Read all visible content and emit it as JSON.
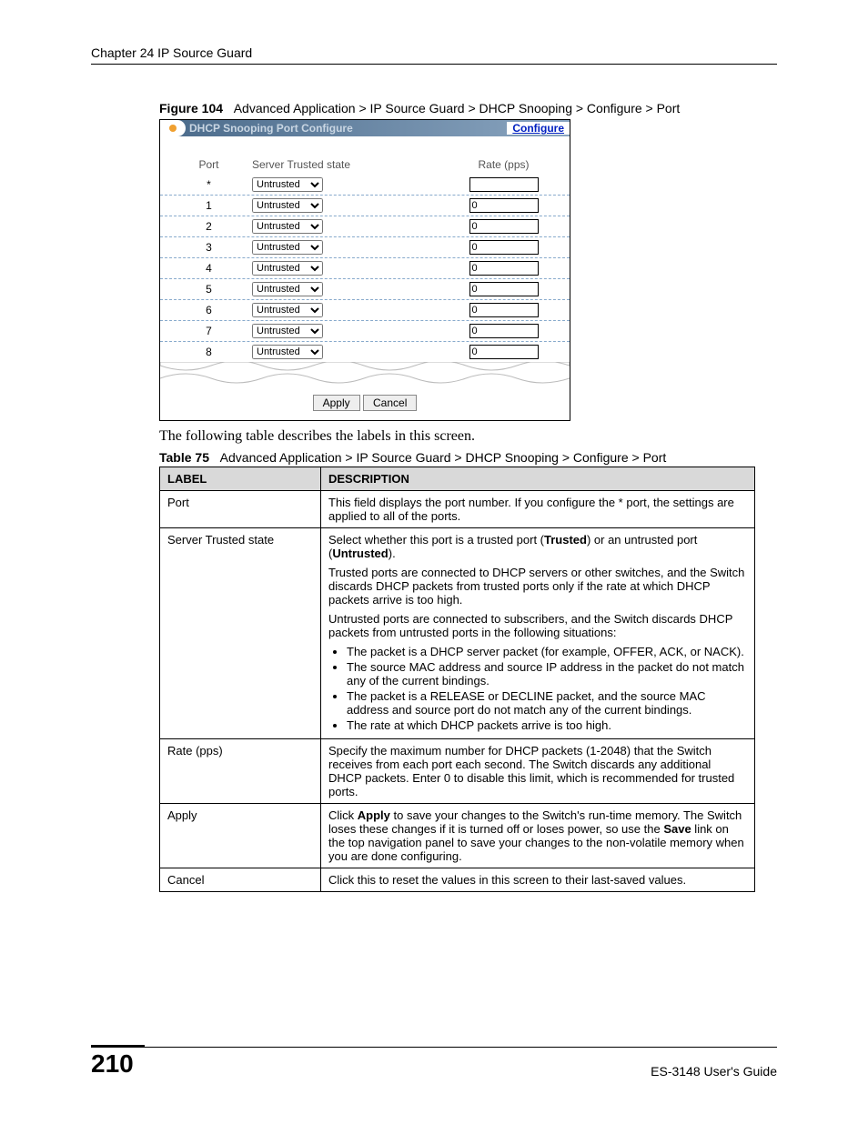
{
  "header": {
    "chapter": "Chapter 24 IP Source Guard"
  },
  "figure": {
    "label": "Figure 104",
    "caption": "Advanced Application > IP Source Guard > DHCP Snooping > Configure > Port"
  },
  "screenshot": {
    "title": "DHCP Snooping Port Configure",
    "configure_link": "Configure",
    "columns": {
      "port": "Port",
      "sts": "Server Trusted state",
      "rate": "Rate (pps)"
    },
    "rows": [
      {
        "port": "*",
        "sts": "Untrusted",
        "rate": ""
      },
      {
        "port": "1",
        "sts": "Untrusted",
        "rate": "0"
      },
      {
        "port": "2",
        "sts": "Untrusted",
        "rate": "0"
      },
      {
        "port": "3",
        "sts": "Untrusted",
        "rate": "0"
      },
      {
        "port": "4",
        "sts": "Untrusted",
        "rate": "0"
      },
      {
        "port": "5",
        "sts": "Untrusted",
        "rate": "0"
      },
      {
        "port": "6",
        "sts": "Untrusted",
        "rate": "0"
      },
      {
        "port": "7",
        "sts": "Untrusted",
        "rate": "0"
      },
      {
        "port": "8",
        "sts": "Untrusted",
        "rate": "0"
      }
    ],
    "buttons": {
      "apply": "Apply",
      "cancel": "Cancel"
    }
  },
  "intro_text": "The following table describes the labels in this screen.",
  "table_caption": {
    "label": "Table 75",
    "caption": "Advanced Application > IP Source Guard > DHCP Snooping > Configure > Port"
  },
  "table": {
    "headers": {
      "label": "LABEL",
      "desc": "DESCRIPTION"
    },
    "rows": [
      {
        "label": "Port",
        "desc_parts": [
          {
            "type": "para",
            "text": "This field displays the port number. If you configure the * port, the settings are applied to all of the ports."
          }
        ]
      },
      {
        "label": "Server Trusted state",
        "desc_parts": [
          {
            "type": "para_html",
            "text": "Select whether this port is a trusted port (<b>Trusted</b>) or an untrusted port (<b>Untrusted</b>)."
          },
          {
            "type": "para",
            "text": "Trusted ports are connected to DHCP servers or other switches, and the Switch discards DHCP packets from trusted ports only if the rate at which DHCP packets arrive is too high."
          },
          {
            "type": "para",
            "text": "Untrusted ports are connected to subscribers, and the Switch discards DHCP packets from untrusted ports in the following situations:"
          },
          {
            "type": "list",
            "items": [
              "The packet is a DHCP server packet (for example, OFFER, ACK, or NACK).",
              "The source MAC address and source IP address in the packet do not match any of the current bindings.",
              "The packet is a RELEASE or DECLINE packet, and the source MAC address and source port do not match any of the current bindings.",
              "The rate at which DHCP packets arrive is too high."
            ]
          }
        ]
      },
      {
        "label": "Rate (pps)",
        "desc_parts": [
          {
            "type": "para",
            "text": "Specify the maximum number for DHCP packets (1-2048) that the Switch receives from each port each second. The Switch discards any additional DHCP packets. Enter 0 to disable this limit, which is recommended for trusted ports."
          }
        ]
      },
      {
        "label": "Apply",
        "desc_parts": [
          {
            "type": "para_html",
            "text": "Click <b>Apply</b> to save your changes to the Switch's run-time memory. The Switch loses these changes if it is turned off or loses power, so use the <b>Save</b> link on the top navigation panel to save your changes to the non-volatile memory when you are done configuring."
          }
        ]
      },
      {
        "label": "Cancel",
        "desc_parts": [
          {
            "type": "para",
            "text": "Click this to reset the values in this screen to their last-saved values."
          }
        ]
      }
    ]
  },
  "footer": {
    "page": "210",
    "guide": "ES-3148 User's Guide"
  }
}
